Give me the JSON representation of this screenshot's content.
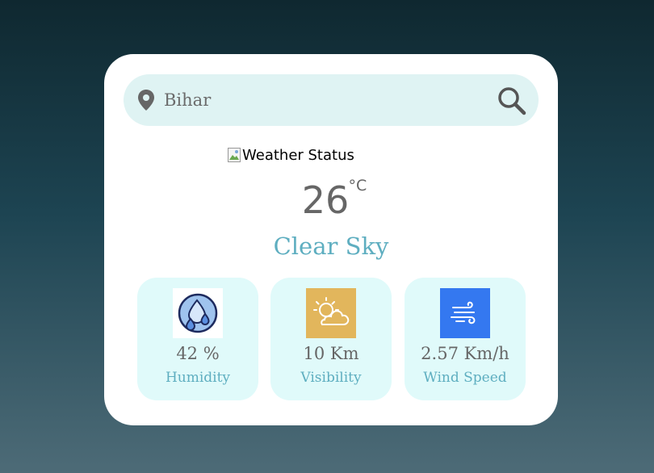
{
  "search": {
    "placeholder": "Bihar",
    "value": "",
    "location_icon": "map-pin-icon",
    "search_icon": "magnifier-icon"
  },
  "weather": {
    "image_alt": "Weather Status",
    "temperature": "26",
    "unit": "°C",
    "condition": "Clear Sky"
  },
  "stats": [
    {
      "icon": "humidity-icon",
      "value": "42 %",
      "label": "Humidity"
    },
    {
      "icon": "visibility-icon",
      "value": "10 Km",
      "label": "Visibility"
    },
    {
      "icon": "wind-icon",
      "value": "2.57 Km/h",
      "label": "Wind Speed"
    }
  ],
  "colors": {
    "accent": "#5eaec0",
    "search_bg": "#dff3f3",
    "stat_bg": "#e0fafa",
    "text_gray": "#666666",
    "visibility_icon_bg": "#e2b65c",
    "wind_icon_bg": "#3478f0"
  }
}
